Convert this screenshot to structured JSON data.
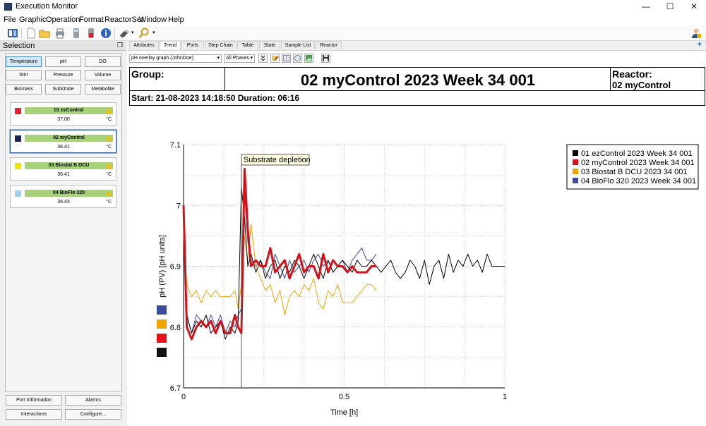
{
  "window": {
    "title": "Execution Monitor",
    "minimize": "—",
    "maximize": "☐",
    "close": "✕"
  },
  "menu": [
    "File",
    "Graphic",
    "Operation",
    "Format",
    "ReactorSet",
    "Window",
    "Help"
  ],
  "selection": {
    "title": "Selection",
    "quantities": [
      "Temperature",
      "pH",
      "DO",
      "Stirr",
      "Pressure",
      "Volume",
      "Biomass",
      "Substrate",
      "Metabolite"
    ],
    "active_quantity": "Temperature",
    "reactors": [
      {
        "name": "01 ezControl",
        "value": "37.00",
        "unit": "°C",
        "color": "#e8202a"
      },
      {
        "name": "02 myControl",
        "value": "36.41",
        "unit": "°C",
        "color": "#1f2257"
      },
      {
        "name": "03 Biostat B DCU",
        "value": "36.41",
        "unit": "°C",
        "color": "#f2e400"
      },
      {
        "name": "04 BioFlo 320",
        "value": "36.43",
        "unit": "°C",
        "color": "#9fd0ef"
      }
    ],
    "selected_reactor": "02 myControl",
    "bottom_buttons": [
      "Port Information",
      "Alarms",
      "Interactions",
      "Configure..."
    ]
  },
  "tabs": [
    "Attributes",
    "Trend",
    "Ports",
    "Step Chain",
    "Table",
    "State",
    "Sample List",
    "Reactor"
  ],
  "active_tab": "Trend",
  "controls": {
    "graph_select": "pH overlay graph (JohnDoe)",
    "phase_select": "All Phases"
  },
  "report": {
    "group_label": "Group:",
    "title": "02 myControl 2023 Week 34 001",
    "reactor_label": "Reactor:",
    "reactor_value": "02 myControl",
    "start_line": "Start: 21-08-2023 14:18:50 Duration: 06:16"
  },
  "chart_data": {
    "type": "line",
    "xlabel": "Time [h]",
    "ylabel": "pH (PV) [pH units]",
    "xlim": [
      0,
      1
    ],
    "ylim": [
      6.7,
      7.1
    ],
    "x_ticks": [
      "0",
      "0.5",
      "1"
    ],
    "y_ticks": [
      "6.7",
      "6.8",
      "6.9",
      "7",
      "7.1"
    ],
    "grid": true,
    "legend_position": "top-right",
    "annotation": {
      "text": "Substrate depletion",
      "x": 0.18
    },
    "series": [
      {
        "name": "01 ezControl 2023 Week 34 001",
        "color": "#000000",
        "width": 1,
        "x": [
          0,
          0.01,
          0.025,
          0.04,
          0.055,
          0.07,
          0.085,
          0.1,
          0.115,
          0.13,
          0.145,
          0.16,
          0.17,
          0.18,
          0.19,
          0.2,
          0.21,
          0.225,
          0.24,
          0.255,
          0.27,
          0.285,
          0.3,
          0.315,
          0.33,
          0.345,
          0.36,
          0.375,
          0.39,
          0.405,
          0.42,
          0.435,
          0.45,
          0.465,
          0.48,
          0.495,
          0.51,
          0.525,
          0.54,
          0.555,
          0.57,
          0.585,
          0.6,
          0.615,
          0.63,
          0.645,
          0.66,
          0.675,
          0.69,
          0.705,
          0.72,
          0.735,
          0.75,
          0.765,
          0.78,
          0.795,
          0.81,
          0.825,
          0.84,
          0.855,
          0.87,
          0.885,
          0.9,
          0.915,
          0.93,
          0.945,
          0.96,
          0.975,
          0.99,
          1.0
        ],
        "y": [
          7.0,
          6.82,
          6.79,
          6.81,
          6.8,
          6.82,
          6.79,
          6.8,
          6.81,
          6.78,
          6.8,
          6.79,
          6.81,
          7.03,
          6.98,
          6.9,
          6.92,
          6.89,
          6.91,
          6.88,
          6.9,
          6.91,
          6.88,
          6.9,
          6.89,
          6.91,
          6.9,
          6.88,
          6.9,
          6.92,
          6.9,
          6.88,
          6.91,
          6.89,
          6.9,
          6.91,
          6.9,
          6.89,
          6.91,
          6.9,
          6.9,
          6.91,
          6.9,
          6.89,
          6.9,
          6.91,
          6.89,
          6.88,
          6.89,
          6.91,
          6.9,
          6.88,
          6.91,
          6.87,
          6.9,
          6.91,
          6.88,
          6.92,
          6.89,
          6.91,
          6.9,
          6.92,
          6.9,
          6.91,
          6.89,
          6.92,
          6.9,
          6.9,
          6.9,
          6.9
        ]
      },
      {
        "name": "02 myControl 2023 Week 34 001",
        "color": "#d41118",
        "width": 3,
        "x": [
          0,
          0.01,
          0.025,
          0.04,
          0.055,
          0.07,
          0.085,
          0.1,
          0.115,
          0.13,
          0.145,
          0.16,
          0.17,
          0.18,
          0.19,
          0.2,
          0.21,
          0.225,
          0.24,
          0.255,
          0.27,
          0.285,
          0.3,
          0.315,
          0.33,
          0.345,
          0.36,
          0.375,
          0.39,
          0.405,
          0.42,
          0.435,
          0.45,
          0.465,
          0.48,
          0.495,
          0.51,
          0.525,
          0.54,
          0.555,
          0.57,
          0.585,
          0.6
        ],
        "y": [
          7.0,
          6.8,
          6.78,
          6.8,
          6.81,
          6.8,
          6.81,
          6.79,
          6.81,
          6.79,
          6.79,
          6.82,
          6.8,
          6.79,
          7.06,
          6.96,
          6.9,
          6.91,
          6.9,
          6.9,
          6.93,
          6.89,
          6.9,
          6.91,
          6.88,
          6.9,
          6.92,
          6.89,
          6.9,
          6.9,
          6.88,
          6.92,
          6.89,
          6.91,
          6.9,
          6.9,
          6.89,
          6.9,
          6.89,
          6.89,
          6.89,
          6.9,
          6.9
        ]
      },
      {
        "name": "03 Biostat B DCU 2023 34 001",
        "color": "#f0a400",
        "width": 1,
        "x": [
          0,
          0.01,
          0.025,
          0.04,
          0.055,
          0.07,
          0.085,
          0.1,
          0.115,
          0.13,
          0.145,
          0.16,
          0.17,
          0.18,
          0.19,
          0.2,
          0.21,
          0.225,
          0.24,
          0.255,
          0.27,
          0.285,
          0.3,
          0.315,
          0.33,
          0.345,
          0.36,
          0.375,
          0.39,
          0.405,
          0.42,
          0.435,
          0.45,
          0.465,
          0.48,
          0.495,
          0.51,
          0.525,
          0.54,
          0.555,
          0.57,
          0.585,
          0.6
        ],
        "y": [
          6.95,
          6.87,
          6.85,
          6.86,
          6.84,
          6.86,
          6.85,
          6.86,
          6.85,
          6.85,
          6.85,
          6.86,
          6.83,
          6.87,
          6.95,
          6.91,
          6.97,
          6.9,
          6.88,
          6.86,
          6.87,
          6.84,
          6.86,
          6.82,
          6.85,
          6.86,
          6.85,
          6.87,
          6.86,
          6.88,
          6.84,
          6.83,
          6.86,
          6.85,
          6.87,
          6.84,
          6.84,
          6.84,
          6.85,
          6.86,
          6.87,
          6.87,
          6.86
        ]
      },
      {
        "name": "04 BioFlo 320 2023 Week 34 001",
        "color": "#3a4a9c",
        "width": 1,
        "x": [
          0,
          0.01,
          0.025,
          0.04,
          0.055,
          0.07,
          0.085,
          0.1,
          0.115,
          0.13,
          0.145,
          0.16,
          0.17,
          0.18,
          0.19,
          0.2,
          0.21,
          0.225,
          0.24,
          0.255,
          0.27,
          0.285,
          0.3,
          0.315,
          0.33,
          0.345,
          0.36,
          0.375,
          0.39,
          0.405,
          0.42,
          0.435,
          0.45,
          0.465,
          0.48,
          0.495,
          0.51,
          0.525,
          0.54,
          0.555,
          0.57,
          0.585,
          0.6
        ],
        "y": [
          6.99,
          6.82,
          6.79,
          6.82,
          6.81,
          6.8,
          6.82,
          6.8,
          6.82,
          6.79,
          6.81,
          6.8,
          6.82,
          6.83,
          7.02,
          6.94,
          6.91,
          6.9,
          6.91,
          6.89,
          6.88,
          6.92,
          6.9,
          6.88,
          6.91,
          6.89,
          6.9,
          6.91,
          6.89,
          6.91,
          6.92,
          6.9,
          6.91,
          6.89,
          6.9,
          6.91,
          6.89,
          6.91,
          6.92,
          6.93,
          6.91,
          6.91,
          6.92
        ]
      }
    ],
    "side_swatches": [
      "#3a4a9c",
      "#f0a400",
      "#e8101a",
      "#111111"
    ]
  }
}
